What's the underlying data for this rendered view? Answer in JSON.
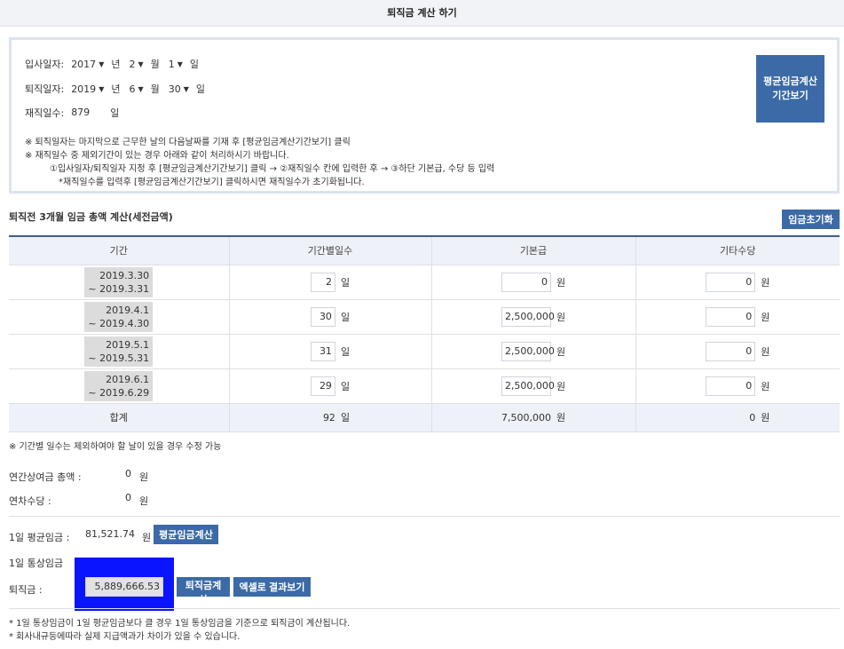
{
  "page_title": "퇴직금 계산 하기",
  "dates": {
    "hire_label": "입사일자:",
    "hire_year": "2017",
    "hire_month": "2",
    "hire_day": "1",
    "retire_label": "퇴직일자:",
    "retire_year": "2019",
    "retire_month": "6",
    "retire_day": "30",
    "unit_year": "년",
    "unit_month": "월",
    "unit_day": "일",
    "service_label": "재직일수:",
    "service_days": "879",
    "service_unit": "일",
    "avg_period_button": "평균임금계산\n기간보기",
    "notes": [
      "※ 퇴직일자는 마지막으로 근무한 날의 다음날짜를 기재 후 [평균임금계산기간보기] 클릭",
      "※ 재직일수 중 제외기간이 있는 경우 아래와 같이 처리하시기 바랍니다.",
      "①입사일자/퇴직일자 지정 후 [평균임금계산기간보기] 클릭 → ②재직일수 칸에 입력한 후 → ③하단 기본급, 수당 등 입력",
      "*재직일수를 입력후 [평균임금계산기간보기] 클릭하시면 재직일수가 초기화됩니다."
    ]
  },
  "wage_section": {
    "title": "퇴직전 3개월 임금 총액 계산(세전금액)",
    "reset_button": "임금초기화",
    "headers": [
      "기간",
      "기간별일수",
      "기본급",
      "기타수당"
    ],
    "day_unit": "일",
    "won_unit": "원",
    "rows": [
      {
        "period_line1": "2019.3.30",
        "period_line2": "~ 2019.3.31",
        "days": "2",
        "base": "0",
        "other": "0"
      },
      {
        "period_line1": "2019.4.1",
        "period_line2": "~ 2019.4.30",
        "days": "30",
        "base": "2,500,000",
        "other": "0"
      },
      {
        "period_line1": "2019.5.1",
        "period_line2": "~ 2019.5.31",
        "days": "31",
        "base": "2,500,000",
        "other": "0"
      },
      {
        "period_line1": "2019.6.1",
        "period_line2": "~ 2019.6.29",
        "days": "29",
        "base": "2,500,000",
        "other": "0"
      }
    ],
    "total": {
      "label": "합계",
      "days": "92",
      "base": "7,500,000",
      "other": "0"
    },
    "note": "※ 기간별 일수는 제외하여야 할 날이 있을 경우 수정 가능"
  },
  "extras": {
    "bonus_label": "연간상여금 총액 :",
    "bonus_value": "0",
    "leave_label": "연차수당 :",
    "leave_value": "0",
    "won_unit": "원"
  },
  "results": {
    "avg_label": "1일 평균임금 :",
    "avg_value": "81,521.74",
    "avg_unit": "원",
    "avg_button": "평균임금계산",
    "ordinary_label": "1일 통상임금",
    "severance_label": "퇴직금 :",
    "severance_value": "5,889,666.53",
    "calc_button": "퇴직금계산",
    "excel_button": "엑셀로 결과보기"
  },
  "footnotes": [
    "* 1일 통상임금이 1일 평균임금보다 클 경우 1일 통상임금을 기준으로 퇴직금이 계산됩니다.",
    "* 회사내규등에따라 실제 지급액과가 차이가 있을 수 있습니다."
  ],
  "colors": {
    "accent": "#3b6aa6",
    "highlight": "#0a14ff",
    "header_bg": "#eef1f7"
  }
}
